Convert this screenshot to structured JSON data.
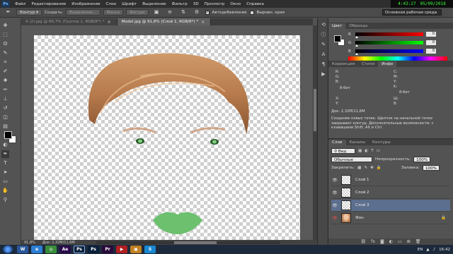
{
  "app": {
    "logo": "Ps",
    "menu": [
      "Файл",
      "Редактирование",
      "Изображение",
      "Слои",
      "Шрифт",
      "Выделение",
      "Фильтр",
      "3D",
      "Просмотр",
      "Окно",
      "Справка"
    ]
  },
  "clock": {
    "time": "4:43:27",
    "date": "05/09/2018"
  },
  "options": {
    "mode": "Контур",
    "make_label": "Создать:",
    "selection_btn": "Выделение...",
    "mask_btn": "Маска",
    "shape_btn": "Фигура",
    "autoadd_label": "Автодобавление",
    "align_edges_label": "Выровн. края",
    "workspace": "Основная рабочая среда"
  },
  "tabs": [
    {
      "label": "4 (2).jpg @ 66,7% (Группа 1, RGB/8*) *",
      "active": false
    },
    {
      "label": "Model.jpg @ 91,8% (Слой 1, RGB/8*) *",
      "active": true
    }
  ],
  "status": {
    "zoom": "91,8%",
    "doc": "Док: 2,32M/11,6M"
  },
  "color_panel": {
    "tabs": [
      "Цвет",
      "Образцы"
    ],
    "sliders": [
      {
        "label": "R",
        "value": "0"
      },
      {
        "label": "G",
        "value": "0"
      },
      {
        "label": "B",
        "value": "0"
      }
    ]
  },
  "info_panel": {
    "tabs": [
      "Коррекция",
      "Стили",
      "Инфо"
    ],
    "r_label": "R:",
    "g_label": "G:",
    "b_label": "B:",
    "bit_left": "8-бит",
    "c_label": "C:",
    "m_label": "M:",
    "y_label": "Y:",
    "k_label": "K:",
    "bit_right": "8-бит",
    "x_label": "X:",
    "y2_label": "Y:",
    "w_label": "Ш:",
    "h_label": "В:",
    "doc_info": "Док: 2,32M/11,6M",
    "hint": "Создание новых точек. Щелчок на начальной точке закрывает контур. Дополнительные возможности: с клавишами Shift, Alt и Ctrl."
  },
  "layers_panel": {
    "tabs": [
      "Слои",
      "Каналы",
      "Контуры"
    ],
    "filter": "Вид",
    "blend": "Обычные",
    "opacity_label": "Непрозрачность:",
    "opacity": "100%",
    "lock_label": "Закрепить:",
    "fill_label": "Заливка:",
    "fill": "100%",
    "layers": [
      {
        "name": "Слой 1",
        "thumb": "transparent",
        "selected": false
      },
      {
        "name": "Слой 2",
        "thumb": "transparent",
        "selected": false
      },
      {
        "name": "Слой 3",
        "thumb": "transparent",
        "selected": true
      },
      {
        "name": "Фон",
        "thumb": "photo",
        "selected": false
      }
    ]
  },
  "taskbar": {
    "apps": [
      {
        "label": "W",
        "color": "#2b579a"
      },
      {
        "label": "e",
        "color": "#2d7fd3"
      },
      {
        "label": "◎",
        "color": "#3a8d3a"
      },
      {
        "label": "Ae",
        "color": "#2a0a4a"
      },
      {
        "label": "Ps",
        "color": "#0a1f3a"
      },
      {
        "label": "Ps",
        "color": "#0a1f3a"
      },
      {
        "label": "Pr",
        "color": "#2a0a3a"
      },
      {
        "label": "▶",
        "color": "#b02020"
      },
      {
        "label": "▣",
        "color": "#c08020"
      },
      {
        "label": "S",
        "color": "#1a88d0"
      }
    ],
    "lang": "EN",
    "time": "16:42"
  },
  "colors": {
    "lips": "#6cc06e",
    "hair": "#b77b4d"
  }
}
